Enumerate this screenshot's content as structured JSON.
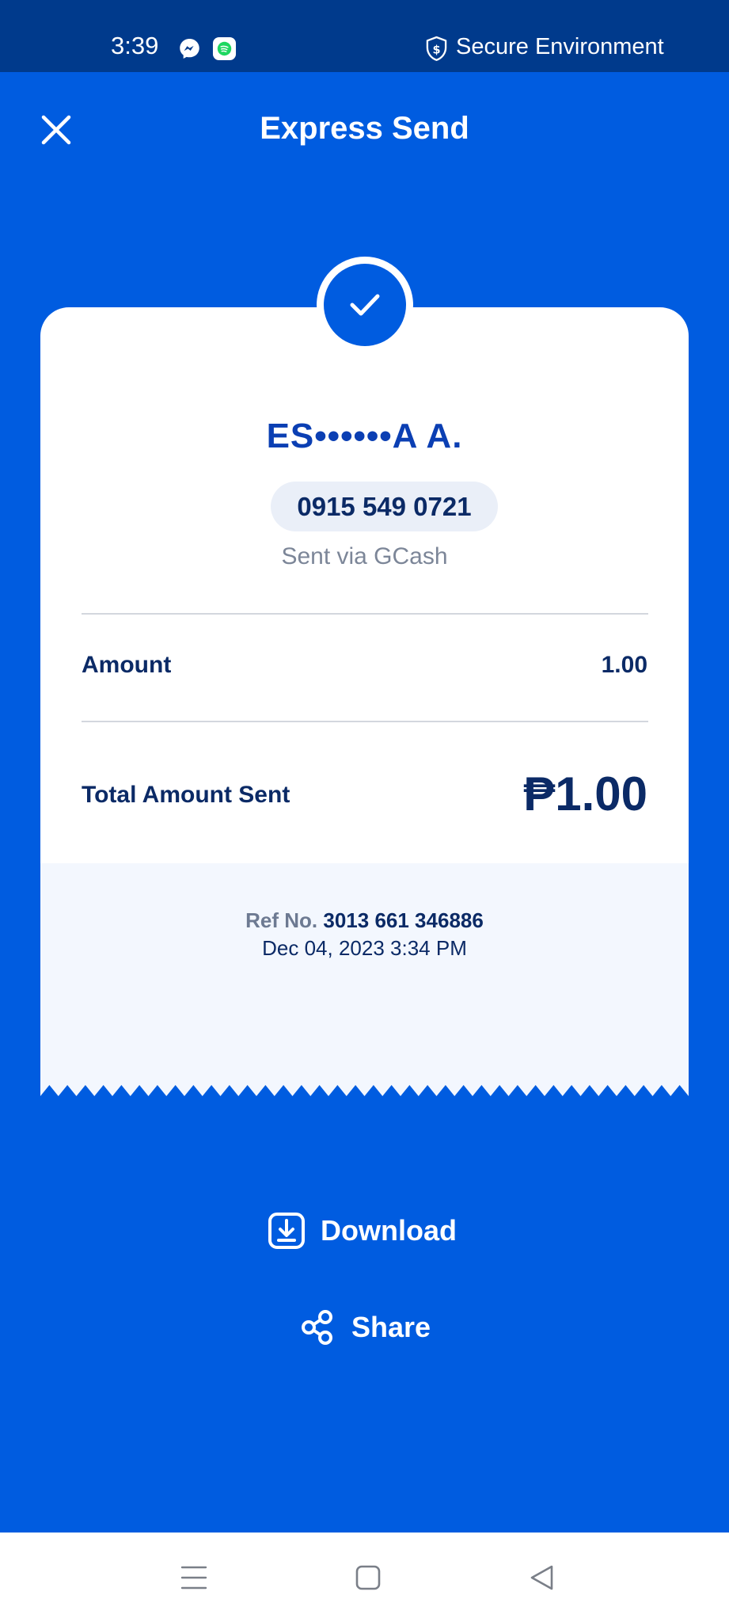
{
  "status_bar": {
    "time": "3:39",
    "secure_label": "Secure Environment",
    "icons": [
      "messenger-icon",
      "chat-app-icon",
      "shield-dollar-icon"
    ]
  },
  "header": {
    "title": "Express Send",
    "close_icon": "close-icon"
  },
  "receipt": {
    "status_icon": "check-icon",
    "recipient_name": "ES••••••A A.",
    "recipient_number": "0915 549 0721",
    "sent_via": "Sent via GCash",
    "amount_label": "Amount",
    "amount_value": "1.00",
    "total_label": "Total Amount Sent",
    "total_value": "₱1.00",
    "ref_label": "Ref No.",
    "ref_number": "3013 661 346886",
    "datetime": "Dec 04, 2023 3:34 PM"
  },
  "actions": {
    "download_label": "Download",
    "download_icon": "download-icon",
    "share_label": "Share",
    "share_icon": "share-icon"
  },
  "nav_bar": {
    "icons": [
      "menu-icon",
      "home-square-icon",
      "back-triangle-icon"
    ]
  },
  "colors": {
    "background": "#005ce0",
    "status_bar": "#003a8c",
    "card": "#ffffff",
    "card_footer": "#f3f7fe",
    "primary_text": "#0b2a66",
    "name_text": "#0b3fb3",
    "muted_text": "#7c8698"
  }
}
